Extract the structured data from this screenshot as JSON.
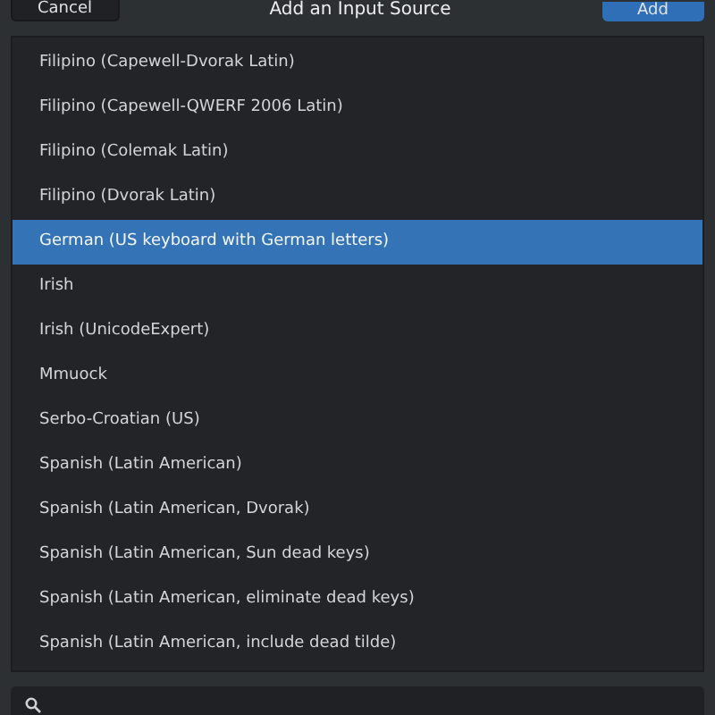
{
  "header": {
    "cancel": "Cancel",
    "title": "Add an Input Source",
    "add": "Add"
  },
  "items": [
    {
      "label": "Filipino (Capewell-Dvorak Latin)",
      "selected": false
    },
    {
      "label": "Filipino (Capewell-QWERF 2006 Latin)",
      "selected": false
    },
    {
      "label": "Filipino (Colemak Latin)",
      "selected": false
    },
    {
      "label": "Filipino (Dvorak Latin)",
      "selected": false
    },
    {
      "label": "German (US keyboard with German letters)",
      "selected": true
    },
    {
      "label": "Irish",
      "selected": false
    },
    {
      "label": "Irish (UnicodeExpert)",
      "selected": false
    },
    {
      "label": "Mmuock",
      "selected": false
    },
    {
      "label": "Serbo-Croatian (US)",
      "selected": false
    },
    {
      "label": "Spanish (Latin American)",
      "selected": false
    },
    {
      "label": "Spanish (Latin American, Dvorak)",
      "selected": false
    },
    {
      "label": "Spanish (Latin American, Sun dead keys)",
      "selected": false
    },
    {
      "label": "Spanish (Latin American, eliminate dead keys)",
      "selected": false
    },
    {
      "label": "Spanish (Latin American, include dead tilde)",
      "selected": false
    }
  ]
}
